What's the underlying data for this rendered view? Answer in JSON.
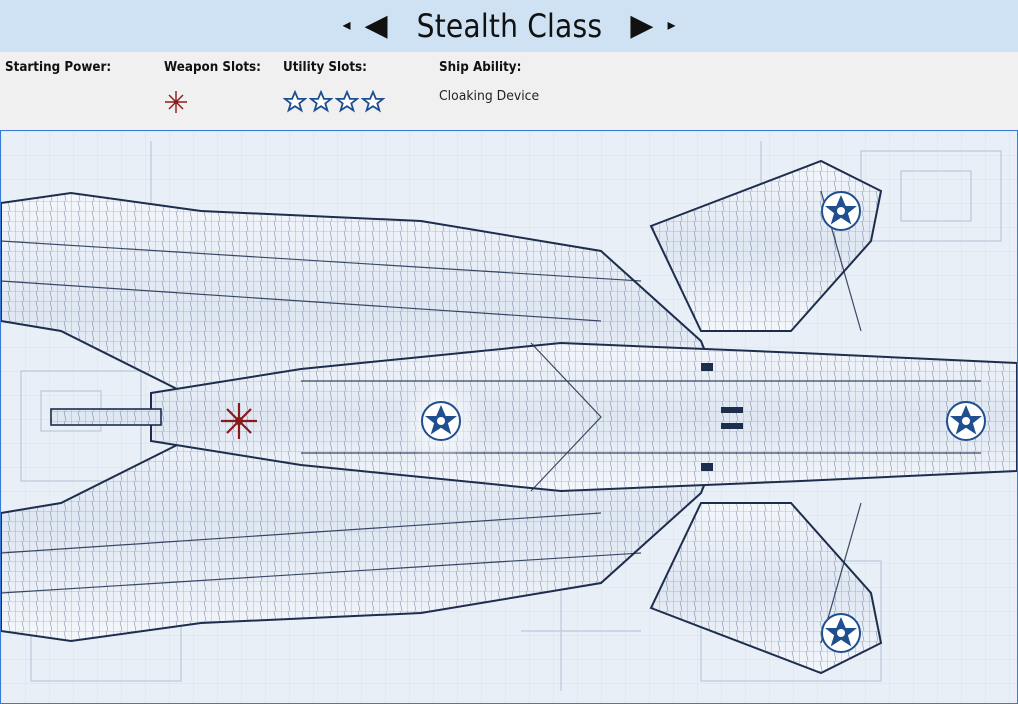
{
  "header": {
    "title": "Stealth Class",
    "prev_small": "◂",
    "prev_big": "◀",
    "next_big": "▶",
    "next_small": "▸"
  },
  "info": {
    "starting_power_label": "Starting Power:",
    "weapon_slots_label": "Weapon Slots:",
    "weapon_slots_count": 1,
    "utility_slots_label": "Utility Slots:",
    "utility_slots_count": 4,
    "ship_ability_label": "Ship Ability:",
    "ship_ability_value": "Cloaking Device"
  },
  "icons": {
    "weapon_slot": "red-starburst-icon",
    "utility_slot": "blue-outline-star-icon",
    "roundel": "blue-star-roundel-icon"
  },
  "colors": {
    "title_bar": "#cfe2f3",
    "info_bar": "#f0f0f0",
    "viewport_border": "#3a79d6",
    "weapon_red": "#8a1a1a",
    "utility_blue": "#1f4f8f",
    "wire_blue": "#2a3f66",
    "blueprint_bg": "#e9eff6"
  }
}
